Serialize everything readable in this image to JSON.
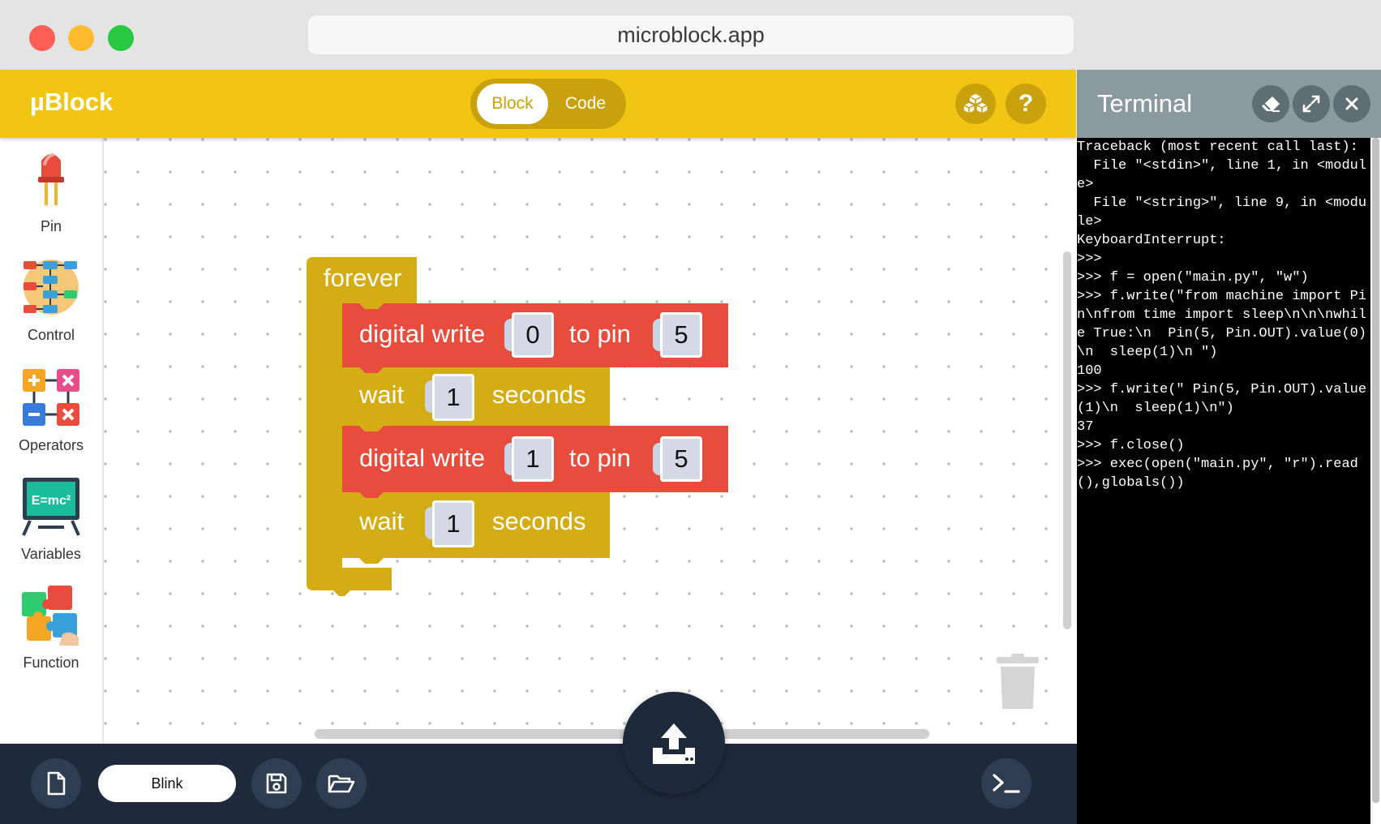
{
  "browser": {
    "url": "microblock.app"
  },
  "header": {
    "brand": "µBlock",
    "mode_toggle": {
      "active": "Block",
      "inactive": "Code"
    },
    "extension_icon": "blocks-icon",
    "help_label": "?"
  },
  "sidebar": {
    "items": [
      {
        "label": "Pin",
        "icon": "led-icon"
      },
      {
        "label": "Control",
        "icon": "flowchart-icon"
      },
      {
        "label": "Operators",
        "icon": "math-operators-icon"
      },
      {
        "label": "Variables",
        "icon": "chalkboard-icon"
      },
      {
        "label": "Function",
        "icon": "puzzle-icon"
      }
    ]
  },
  "workspace": {
    "program": {
      "hat": "forever",
      "blocks": [
        {
          "type": "digital_write",
          "label": "digital write",
          "value": "0",
          "pin_label": "to pin",
          "pin": "5"
        },
        {
          "type": "wait",
          "label": "wait",
          "value": "1",
          "unit": "seconds"
        },
        {
          "type": "digital_write",
          "label": "digital write",
          "value": "1",
          "pin_label": "to pin",
          "pin": "5"
        },
        {
          "type": "wait",
          "label": "wait",
          "value": "1",
          "unit": "seconds"
        }
      ]
    },
    "colors": {
      "forever": "#d4ad14",
      "digital_write": "#e84c3d",
      "wait": "#d4ad14",
      "slot": "#d5d9e6"
    }
  },
  "bottom_bar": {
    "project_name": "Blink"
  },
  "terminal": {
    "title": "Terminal",
    "output": "Traceback (most recent call last):\n  File \"<stdin>\", line 1, in <module>\n  File \"<string>\", line 9, in <module>\nKeyboardInterrupt:\n>>>\n>>> f = open(\"main.py\", \"w\")\n>>> f.write(\"from machine import Pin\\nfrom time import sleep\\n\\n\\nwhile True:\\n  Pin(5, Pin.OUT).value(0)\\n  sleep(1)\\n \")\n100\n>>> f.write(\" Pin(5, Pin.OUT).value(1)\\n  sleep(1)\\n\")\n37\n>>> f.close()\n>>> exec(open(\"main.py\", \"r\").read(),globals())"
  }
}
